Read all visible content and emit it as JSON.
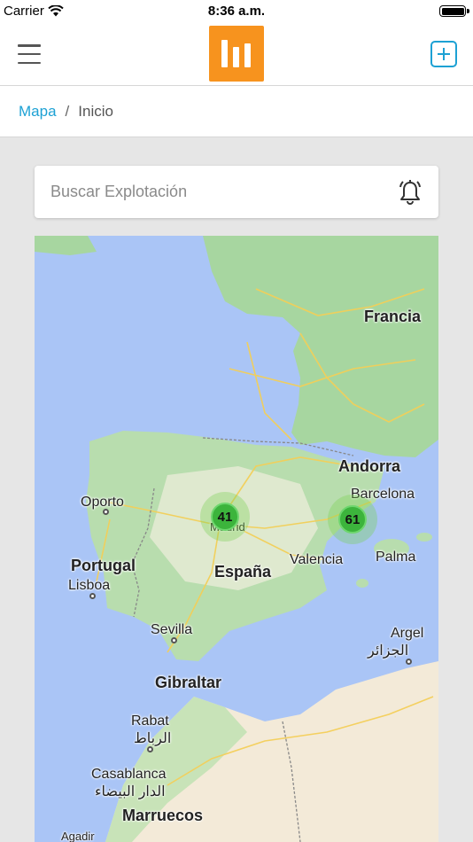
{
  "status_bar": {
    "carrier": "Carrier",
    "time": "8:36 a.m."
  },
  "nav": {
    "logo_color": "#f7931e",
    "accent_color": "#1da1d4"
  },
  "breadcrumb": {
    "link": "Mapa",
    "separator": "/",
    "current": "Inicio"
  },
  "search": {
    "placeholder": "Buscar Explotación",
    "icon": "bell-alert-icon"
  },
  "map": {
    "countries": [
      "Francia",
      "Andorra",
      "Portugal",
      "España",
      "Gibraltar",
      "Marruecos"
    ],
    "cities": [
      "Barcelona",
      "Oporto",
      "Lisboa",
      "Madrid",
      "Valencia",
      "Palma",
      "Sevilla",
      "Argel",
      "الجزائر",
      "Rabat",
      "الرباط",
      "Casablanca",
      "الدار البيضاء",
      "Agadir"
    ],
    "clusters": [
      {
        "label": "41",
        "location": "Madrid"
      },
      {
        "label": "61",
        "location": "Valencia"
      }
    ]
  }
}
